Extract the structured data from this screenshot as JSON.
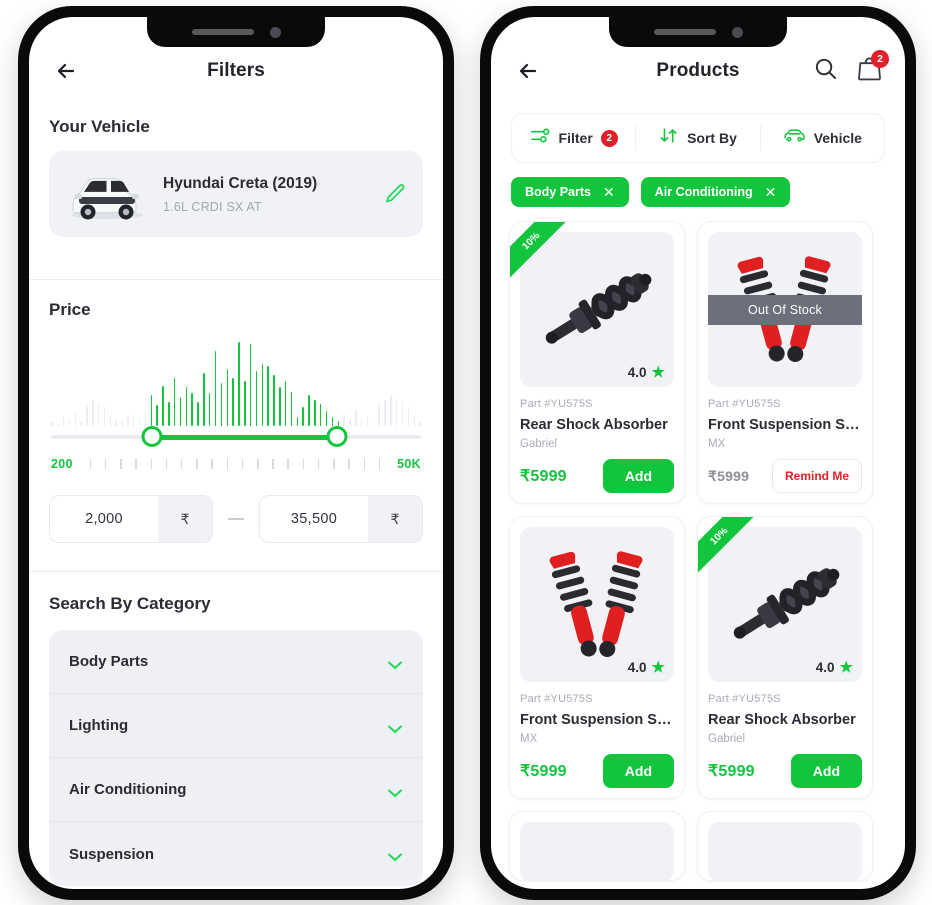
{
  "theme": {
    "green": "#13c53d",
    "red": "#e3202a",
    "gray_overlay": "#6e6f7c",
    "panel": "#f1f2f6"
  },
  "filters_screen": {
    "title": "Filters",
    "back_icon": "arrow-left-icon",
    "vehicle_section": {
      "heading": "Your Vehicle",
      "name": "Hyundai Creta (2019)",
      "variant": "1.6L CRDI SX AT",
      "edit_icon": "pencil-icon"
    },
    "price_section": {
      "heading": "Price",
      "min_label": "200",
      "max_label": "50K",
      "min_value": "2,000",
      "max_value": "35,500",
      "currency": "₹",
      "separator": "—",
      "tick_count": 20,
      "histogram": [
        5,
        4,
        12,
        7,
        18,
        5,
        24,
        30,
        26,
        22,
        14,
        7,
        6,
        10,
        14,
        9,
        18,
        36,
        24,
        47,
        28,
        56,
        34,
        46,
        39,
        28,
        62,
        38,
        88,
        50,
        66,
        56,
        98,
        52,
        96,
        64,
        72,
        70,
        60,
        46,
        52,
        40,
        10,
        22,
        36,
        30,
        26,
        18,
        10,
        6,
        14,
        8,
        20,
        6,
        12,
        5,
        26,
        30,
        36,
        32,
        28,
        22,
        12,
        6
      ],
      "active_from_index": 17,
      "active_to_index": 49
    },
    "category_section": {
      "heading": "Search By Category",
      "items": [
        {
          "label": "Body Parts",
          "chevron": "chevron-down-icon"
        },
        {
          "label": "Lighting",
          "chevron": "chevron-down-icon"
        },
        {
          "label": "Air Conditioning",
          "chevron": "chevron-down-icon"
        },
        {
          "label": "Suspension",
          "chevron": "chevron-down-icon"
        }
      ]
    }
  },
  "products_screen": {
    "title": "Products",
    "back_icon": "arrow-left-icon",
    "search_icon": "search-icon",
    "cart_icon": "shopping-bag-icon",
    "cart_count": "2",
    "toolbar": [
      {
        "label": "Filter",
        "icon": "filter-sliders-icon",
        "badge": "2"
      },
      {
        "label": "Sort By",
        "icon": "sort-arrows-icon",
        "badge": ""
      },
      {
        "label": "Vehicle",
        "icon": "car-icon",
        "badge": ""
      }
    ],
    "chips": [
      {
        "label": "Body Parts",
        "remove_icon": "close-icon"
      },
      {
        "label": "Air Conditioning",
        "remove_icon": "close-icon"
      }
    ],
    "products": [
      {
        "discount": "10%",
        "image": "shock-absorber-black",
        "rating": "4.0",
        "part": "Part #YU575S",
        "name": "Rear Shock Absorber",
        "brand": "Gabriel",
        "price": "₹5999",
        "action": "Add",
        "in_stock": true,
        "stock_label": ""
      },
      {
        "discount": "",
        "image": "strut-pair-red",
        "rating": "",
        "part": "Part #YU575S",
        "name": "Front Suspension Stru...",
        "brand": "MX",
        "price": "₹5999",
        "action": "Remind Me",
        "in_stock": false,
        "stock_label": "Out Of Stock"
      },
      {
        "discount": "",
        "image": "strut-pair-red",
        "rating": "4.0",
        "part": "Part #YU575S",
        "name": "Front Suspension Stru...",
        "brand": "MX",
        "price": "₹5999",
        "action": "Add",
        "in_stock": true,
        "stock_label": ""
      },
      {
        "discount": "10%",
        "image": "shock-absorber-black",
        "rating": "4.0",
        "part": "Part #YU575S",
        "name": "Rear Shock Absorber",
        "brand": "Gabriel",
        "price": "₹5999",
        "action": "Add",
        "in_stock": true,
        "stock_label": ""
      }
    ]
  }
}
